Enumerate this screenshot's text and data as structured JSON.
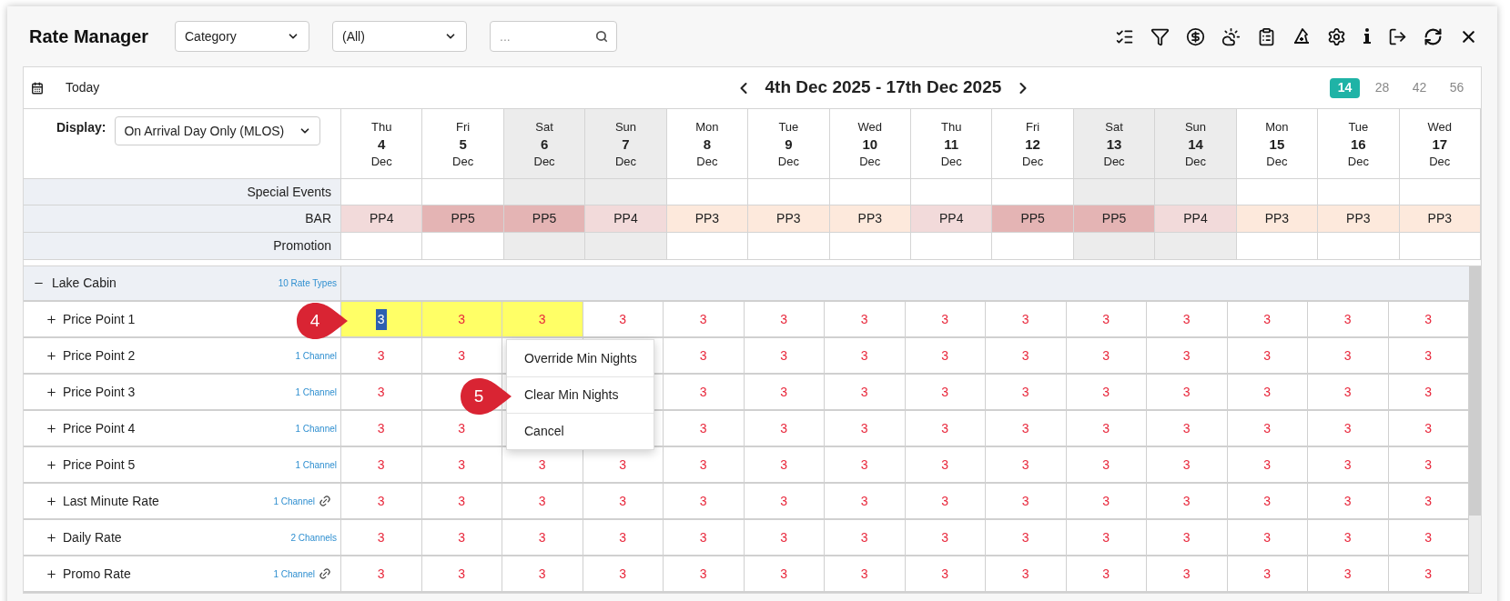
{
  "title": "Rate Manager",
  "filters": [
    {
      "kind": "select",
      "value": "Category"
    },
    {
      "kind": "select",
      "value": "(All)"
    },
    {
      "kind": "search",
      "placeholder": "..."
    }
  ],
  "nav": {
    "today": "Today",
    "range": "4th Dec 2025 - 17th Dec 2025",
    "spans": [
      {
        "label": "14",
        "selected": true
      },
      {
        "label": "28",
        "selected": false
      },
      {
        "label": "42",
        "selected": false
      },
      {
        "label": "56",
        "selected": false
      }
    ]
  },
  "display": {
    "label": "Display:",
    "value": "On Arrival Day Only (MLOS)"
  },
  "days": [
    {
      "weekday": "Thu",
      "day": "4",
      "month": "Dec",
      "weekend": false
    },
    {
      "weekday": "Fri",
      "day": "5",
      "month": "Dec",
      "weekend": false
    },
    {
      "weekday": "Sat",
      "day": "6",
      "month": "Dec",
      "weekend": true
    },
    {
      "weekday": "Sun",
      "day": "7",
      "month": "Dec",
      "weekend": true
    },
    {
      "weekday": "Mon",
      "day": "8",
      "month": "Dec",
      "weekend": false
    },
    {
      "weekday": "Tue",
      "day": "9",
      "month": "Dec",
      "weekend": false
    },
    {
      "weekday": "Wed",
      "day": "10",
      "month": "Dec",
      "weekend": false
    },
    {
      "weekday": "Thu",
      "day": "11",
      "month": "Dec",
      "weekend": false
    },
    {
      "weekday": "Fri",
      "day": "12",
      "month": "Dec",
      "weekend": false
    },
    {
      "weekday": "Sat",
      "day": "13",
      "month": "Dec",
      "weekend": true
    },
    {
      "weekday": "Sun",
      "day": "14",
      "month": "Dec",
      "weekend": true
    },
    {
      "weekday": "Mon",
      "day": "15",
      "month": "Dec",
      "weekend": false
    },
    {
      "weekday": "Tue",
      "day": "16",
      "month": "Dec",
      "weekend": false
    },
    {
      "weekday": "Wed",
      "day": "17",
      "month": "Dec",
      "weekend": false
    }
  ],
  "special_events": {
    "label": "Special Events"
  },
  "bar": {
    "label": "BAR",
    "cells": [
      {
        "value": "PP4",
        "color": "#f2dada"
      },
      {
        "value": "PP5",
        "color": "#e4b4b4"
      },
      {
        "value": "PP5",
        "color": "#e4b4b4"
      },
      {
        "value": "PP4",
        "color": "#f2dada"
      },
      {
        "value": "PP3",
        "color": "#fde9dc"
      },
      {
        "value": "PP3",
        "color": "#fde9dc"
      },
      {
        "value": "PP3",
        "color": "#fde9dc"
      },
      {
        "value": "PP4",
        "color": "#f2dada"
      },
      {
        "value": "PP5",
        "color": "#e4b4b4"
      },
      {
        "value": "PP5",
        "color": "#e4b4b4"
      },
      {
        "value": "PP4",
        "color": "#f2dada"
      },
      {
        "value": "PP3",
        "color": "#fde9dc"
      },
      {
        "value": "PP3",
        "color": "#fde9dc"
      },
      {
        "value": "PP3",
        "color": "#fde9dc"
      }
    ]
  },
  "promotion": {
    "label": "Promotion"
  },
  "group": {
    "name": "Lake Cabin",
    "count": "10 Rate Types",
    "expanded": true,
    "rows": [
      {
        "name": "Price Point 1",
        "expanded": false,
        "linked": false,
        "cells": [
          {
            "value": "3",
            "selected": true,
            "text_selected": true
          },
          {
            "value": "3",
            "selected": true,
            "text_selected": false
          },
          {
            "value": "3",
            "selected": true,
            "text_selected": false
          },
          {
            "value": "3",
            "selected": false,
            "text_selected": false
          },
          {
            "value": "3",
            "selected": false,
            "text_selected": false
          },
          {
            "value": "3",
            "selected": false,
            "text_selected": false
          },
          {
            "value": "3",
            "selected": false,
            "text_selected": false
          },
          {
            "value": "3",
            "selected": false,
            "text_selected": false
          },
          {
            "value": "3",
            "selected": false,
            "text_selected": false
          },
          {
            "value": "3",
            "selected": false,
            "text_selected": false
          },
          {
            "value": "3",
            "selected": false,
            "text_selected": false
          },
          {
            "value": "3",
            "selected": false,
            "text_selected": false
          },
          {
            "value": "3",
            "selected": false,
            "text_selected": false
          },
          {
            "value": "3",
            "selected": false,
            "text_selected": false
          }
        ]
      },
      {
        "name": "Price Point 2",
        "channels": "1 Channel",
        "expanded": false,
        "linked": false,
        "cells": [
          {
            "value": "3",
            "selected": false,
            "text_selected": false
          },
          {
            "value": "3",
            "selected": false,
            "text_selected": false
          },
          {
            "selected": false
          },
          {
            "selected": false
          },
          {
            "value": "3",
            "selected": false,
            "text_selected": false
          },
          {
            "value": "3",
            "selected": false,
            "text_selected": false
          },
          {
            "value": "3",
            "selected": false,
            "text_selected": false
          },
          {
            "value": "3",
            "selected": false,
            "text_selected": false
          },
          {
            "value": "3",
            "selected": false,
            "text_selected": false
          },
          {
            "value": "3",
            "selected": false,
            "text_selected": false
          },
          {
            "value": "3",
            "selected": false,
            "text_selected": false
          },
          {
            "value": "3",
            "selected": false,
            "text_selected": false
          },
          {
            "value": "3",
            "selected": false,
            "text_selected": false
          },
          {
            "value": "3",
            "selected": false,
            "text_selected": false
          }
        ]
      },
      {
        "name": "Price Point 3",
        "channels": "1 Channel",
        "expanded": false,
        "linked": false,
        "cells": [
          {
            "value": "3",
            "selected": false,
            "text_selected": false
          },
          {
            "selected": false
          },
          {
            "selected": false
          },
          {
            "selected": false
          },
          {
            "value": "3",
            "selected": false,
            "text_selected": false
          },
          {
            "value": "3",
            "selected": false,
            "text_selected": false
          },
          {
            "value": "3",
            "selected": false,
            "text_selected": false
          },
          {
            "value": "3",
            "selected": false,
            "text_selected": false
          },
          {
            "value": "3",
            "selected": false,
            "text_selected": false
          },
          {
            "value": "3",
            "selected": false,
            "text_selected": false
          },
          {
            "value": "3",
            "selected": false,
            "text_selected": false
          },
          {
            "value": "3",
            "selected": false,
            "text_selected": false
          },
          {
            "value": "3",
            "selected": false,
            "text_selected": false
          },
          {
            "value": "3",
            "selected": false,
            "text_selected": false
          }
        ]
      },
      {
        "name": "Price Point 4",
        "channels": "1 Channel",
        "expanded": false,
        "linked": false,
        "cells": [
          {
            "value": "3",
            "selected": false,
            "text_selected": false
          },
          {
            "value": "3",
            "selected": false,
            "text_selected": false
          },
          {
            "selected": false
          },
          {
            "selected": false
          },
          {
            "value": "3",
            "selected": false,
            "text_selected": false
          },
          {
            "value": "3",
            "selected": false,
            "text_selected": false
          },
          {
            "value": "3",
            "selected": false,
            "text_selected": false
          },
          {
            "value": "3",
            "selected": false,
            "text_selected": false
          },
          {
            "value": "3",
            "selected": false,
            "text_selected": false
          },
          {
            "value": "3",
            "selected": false,
            "text_selected": false
          },
          {
            "value": "3",
            "selected": false,
            "text_selected": false
          },
          {
            "value": "3",
            "selected": false,
            "text_selected": false
          },
          {
            "value": "3",
            "selected": false,
            "text_selected": false
          },
          {
            "value": "3",
            "selected": false,
            "text_selected": false
          }
        ]
      },
      {
        "name": "Price Point 5",
        "channels": "1 Channel",
        "expanded": false,
        "linked": false,
        "cells": [
          {
            "value": "3",
            "selected": false,
            "text_selected": false
          },
          {
            "value": "3",
            "selected": false,
            "text_selected": false
          },
          {
            "value": "3",
            "selected": false,
            "text_selected": false
          },
          {
            "value": "3",
            "selected": false,
            "text_selected": false
          },
          {
            "value": "3",
            "selected": false,
            "text_selected": false
          },
          {
            "value": "3",
            "selected": false,
            "text_selected": false
          },
          {
            "value": "3",
            "selected": false,
            "text_selected": false
          },
          {
            "value": "3",
            "selected": false,
            "text_selected": false
          },
          {
            "value": "3",
            "selected": false,
            "text_selected": false
          },
          {
            "value": "3",
            "selected": false,
            "text_selected": false
          },
          {
            "value": "3",
            "selected": false,
            "text_selected": false
          },
          {
            "value": "3",
            "selected": false,
            "text_selected": false
          },
          {
            "value": "3",
            "selected": false,
            "text_selected": false
          },
          {
            "value": "3",
            "selected": false,
            "text_selected": false
          }
        ]
      },
      {
        "name": "Last Minute Rate",
        "channels": "1 Channel",
        "expanded": false,
        "linked": true,
        "cells": [
          {
            "value": "3",
            "selected": false,
            "text_selected": false
          },
          {
            "value": "3",
            "selected": false,
            "text_selected": false
          },
          {
            "value": "3",
            "selected": false,
            "text_selected": false
          },
          {
            "value": "3",
            "selected": false,
            "text_selected": false
          },
          {
            "value": "3",
            "selected": false,
            "text_selected": false
          },
          {
            "value": "3",
            "selected": false,
            "text_selected": false
          },
          {
            "value": "3",
            "selected": false,
            "text_selected": false
          },
          {
            "value": "3",
            "selected": false,
            "text_selected": false
          },
          {
            "value": "3",
            "selected": false,
            "text_selected": false
          },
          {
            "value": "3",
            "selected": false,
            "text_selected": false
          },
          {
            "value": "3",
            "selected": false,
            "text_selected": false
          },
          {
            "value": "3",
            "selected": false,
            "text_selected": false
          },
          {
            "value": "3",
            "selected": false,
            "text_selected": false
          },
          {
            "value": "3",
            "selected": false,
            "text_selected": false
          }
        ]
      },
      {
        "name": "Daily Rate",
        "channels": "2 Channels",
        "expanded": false,
        "linked": false,
        "cells": [
          {
            "value": "3",
            "selected": false,
            "text_selected": false
          },
          {
            "value": "3",
            "selected": false,
            "text_selected": false
          },
          {
            "value": "3",
            "selected": false,
            "text_selected": false
          },
          {
            "value": "3",
            "selected": false,
            "text_selected": false
          },
          {
            "value": "3",
            "selected": false,
            "text_selected": false
          },
          {
            "value": "3",
            "selected": false,
            "text_selected": false
          },
          {
            "value": "3",
            "selected": false,
            "text_selected": false
          },
          {
            "value": "3",
            "selected": false,
            "text_selected": false
          },
          {
            "value": "3",
            "selected": false,
            "text_selected": false
          },
          {
            "value": "3",
            "selected": false,
            "text_selected": false
          },
          {
            "value": "3",
            "selected": false,
            "text_selected": false
          },
          {
            "value": "3",
            "selected": false,
            "text_selected": false
          },
          {
            "value": "3",
            "selected": false,
            "text_selected": false
          },
          {
            "value": "3",
            "selected": false,
            "text_selected": false
          }
        ]
      },
      {
        "name": "Promo Rate",
        "channels": "1 Channel",
        "expanded": false,
        "linked": true,
        "cells": [
          {
            "value": "3",
            "selected": false,
            "text_selected": false
          },
          {
            "value": "3",
            "selected": false,
            "text_selected": false
          },
          {
            "value": "3",
            "selected": false,
            "text_selected": false
          },
          {
            "value": "3",
            "selected": false,
            "text_selected": false
          },
          {
            "value": "3",
            "selected": false,
            "text_selected": false
          },
          {
            "value": "3",
            "selected": false,
            "text_selected": false
          },
          {
            "value": "3",
            "selected": false,
            "text_selected": false
          },
          {
            "value": "3",
            "selected": false,
            "text_selected": false
          },
          {
            "value": "3",
            "selected": false,
            "text_selected": false
          },
          {
            "value": "3",
            "selected": false,
            "text_selected": false
          },
          {
            "value": "3",
            "selected": false,
            "text_selected": false
          },
          {
            "value": "3",
            "selected": false,
            "text_selected": false
          },
          {
            "value": "3",
            "selected": false,
            "text_selected": false
          },
          {
            "value": "3",
            "selected": false,
            "text_selected": false
          }
        ]
      }
    ]
  },
  "context_menu": [
    "Override Min Nights",
    "Clear Min Nights",
    "Cancel"
  ],
  "callouts": [
    "4",
    "5"
  ]
}
